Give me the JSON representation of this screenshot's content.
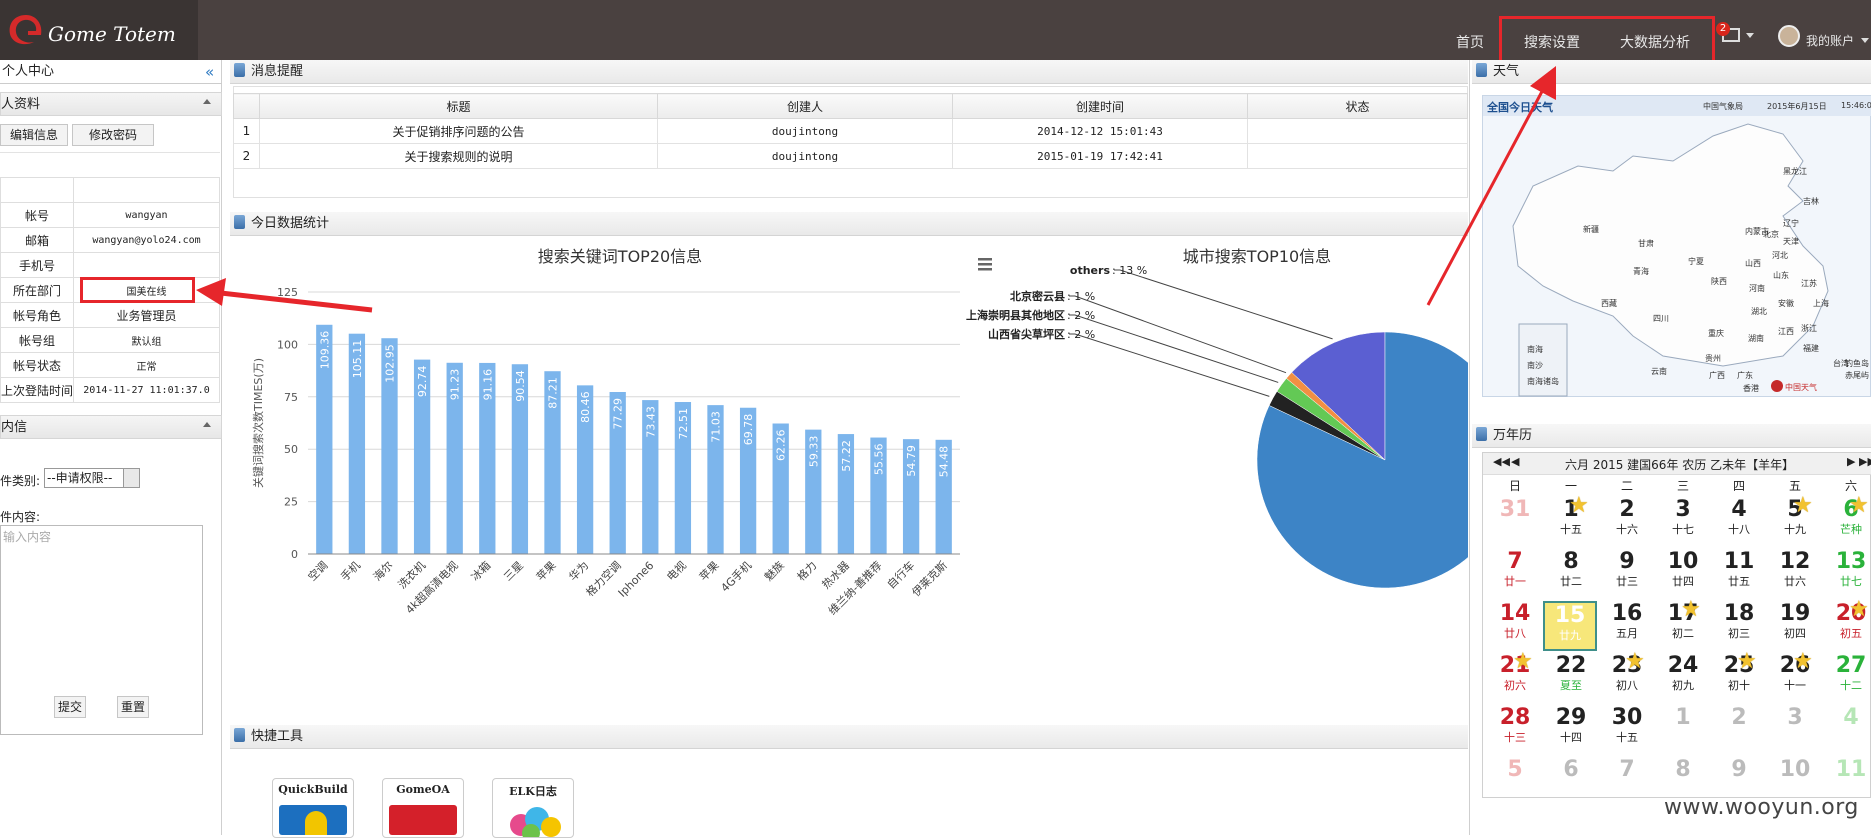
{
  "brand": {
    "logo_text": "Gome Totem"
  },
  "nav": {
    "home": "首页",
    "search_settings": "搜索设置",
    "bigdata": "大数据分析",
    "mail_badge": "2",
    "account": "我的账户"
  },
  "left": {
    "title": "个人中心",
    "profile_head": "人资料",
    "edit_info": "编辑信息",
    "change_pwd": "修改密码",
    "rows": [
      {
        "label": "帐号",
        "value": "wangyan"
      },
      {
        "label": "邮箱",
        "value": "wangyan@yolo24.com"
      },
      {
        "label": "手机号",
        "value": ""
      },
      {
        "label": "所在部门",
        "value": "国美在线"
      },
      {
        "label": "帐号角色",
        "value": "业务管理员"
      },
      {
        "label": "帐号组",
        "value": "默认组"
      },
      {
        "label": "帐号状态",
        "value": "正常"
      },
      {
        "label": "上次登陆时间",
        "value": "2014-11-27 11:01:37.0"
      }
    ],
    "letter_head": "内信",
    "type_label": "件类别:",
    "type_value": "--申请权限--",
    "content_label": "件内容:",
    "content_placeholder": "输入内容",
    "submit": "提交",
    "reset": "重置"
  },
  "messages": {
    "title": "消息提醒",
    "columns": [
      "标题",
      "创建人",
      "创建时间",
      "状态"
    ],
    "rows": [
      {
        "no": "1",
        "title": "关于促销排序问题的公告",
        "creator": "doujintong",
        "time": "2014-12-12 15:01:43",
        "status": ""
      },
      {
        "no": "2",
        "title": "关于搜索规则的说明",
        "creator": "doujintong",
        "time": "2015-01-19 17:42:41",
        "status": ""
      }
    ]
  },
  "stats": {
    "title": "今日数据统计"
  },
  "chart_data": [
    {
      "type": "bar",
      "title": "搜索关键词TOP20信息",
      "ylabel": "关键词搜索次数TIMES(万)",
      "xlabel": "",
      "ylim": [
        0,
        125
      ],
      "yticks": [
        0,
        25,
        50,
        75,
        100,
        125
      ],
      "categories": [
        "空调",
        "手机",
        "海尔",
        "洗衣机",
        "4k超高清电视",
        "冰箱",
        "三星",
        "苹果",
        "华为",
        "格力空调",
        "Iphone6",
        "电视",
        "苹果",
        "4G手机",
        "魅族",
        "格力",
        "热水器",
        "维兰纳-善推荐",
        "自行车",
        "伊莱克斯"
      ],
      "values": [
        109.36,
        105.11,
        102.95,
        92.74,
        91.23,
        91.16,
        90.54,
        87.21,
        80.46,
        77.29,
        73.43,
        72.51,
        71.03,
        69.78,
        62.26,
        59.33,
        57.22,
        55.56,
        54.79,
        54.48
      ],
      "color": "#7cb5ec",
      "grid": true,
      "legend": "none"
    },
    {
      "type": "pie",
      "title": "城市搜索TOP10信息",
      "slices": [
        {
          "label": "others",
          "value": 13,
          "color": "#5b5fd2"
        },
        {
          "label": "北京密云县",
          "value": 1,
          "color": "#f28f43"
        },
        {
          "label": "上海崇明县其他地区",
          "value": 2,
          "color": "#63c955"
        },
        {
          "label": "山西省尖草坪区",
          "value": 2,
          "color": "#222222"
        },
        {
          "label": "",
          "value": 82,
          "color": "#3d84c6"
        }
      ],
      "percent_suffix": " %"
    }
  ],
  "tools": {
    "title": "快捷工具",
    "items": [
      {
        "label": "QuickBuild"
      },
      {
        "label": "GomeOA"
      },
      {
        "label": "ELK日志"
      }
    ]
  },
  "weather": {
    "title": "天气",
    "map_title": "全国今日天气",
    "source": "中国气象局",
    "date": "2015年6月15日",
    "time": "15:46:0",
    "cities": [
      "黑龙江",
      "吉林",
      "辽宁",
      "内蒙古",
      "北京",
      "天津",
      "河北",
      "山西",
      "新疆",
      "甘肃",
      "宁夏",
      "山东",
      "青海",
      "陕西",
      "河南",
      "江苏",
      "西藏",
      "四川",
      "湖北",
      "安徽",
      "上海",
      "重庆",
      "湖南",
      "江西",
      "浙江",
      "贵州",
      "福建",
      "台湾",
      "云南",
      "广西",
      "广东",
      "香港",
      "澳门",
      "海南",
      "钓鱼岛",
      "赤尾屿"
    ],
    "inset": [
      "南海",
      "南沙",
      "南海诸岛"
    ],
    "corner": "中国天气"
  },
  "calendar": {
    "title": "万年历",
    "header": "六月 2015 建国66年 农历 乙未年【羊年】",
    "weekdays": [
      "日",
      "一",
      "二",
      "三",
      "四",
      "五",
      "六"
    ],
    "weeks": [
      [
        {
          "d": "31",
          "l": "",
          "t": "prev"
        },
        {
          "d": "1",
          "l": "十五",
          "t": "n",
          "s": true
        },
        {
          "d": "2",
          "l": "十六",
          "t": "n"
        },
        {
          "d": "3",
          "l": "十七",
          "t": "n"
        },
        {
          "d": "4",
          "l": "十八",
          "t": "n"
        },
        {
          "d": "5",
          "l": "十九",
          "t": "n",
          "s": true
        },
        {
          "d": "6",
          "l": "芒种",
          "t": "sat",
          "s": true
        }
      ],
      [
        {
          "d": "7",
          "l": "廿一",
          "t": "sun"
        },
        {
          "d": "8",
          "l": "廿二",
          "t": "n"
        },
        {
          "d": "9",
          "l": "廿三",
          "t": "n"
        },
        {
          "d": "10",
          "l": "廿四",
          "t": "n"
        },
        {
          "d": "11",
          "l": "廿五",
          "t": "n"
        },
        {
          "d": "12",
          "l": "廿六",
          "t": "n"
        },
        {
          "d": "13",
          "l": "廿七",
          "t": "sat"
        }
      ],
      [
        {
          "d": "14",
          "l": "廿八",
          "t": "sun"
        },
        {
          "d": "15",
          "l": "廿九",
          "t": "today"
        },
        {
          "d": "16",
          "l": "五月",
          "t": "n"
        },
        {
          "d": "17",
          "l": "初二",
          "t": "n",
          "s": true
        },
        {
          "d": "18",
          "l": "初三",
          "t": "n"
        },
        {
          "d": "19",
          "l": "初四",
          "t": "n"
        },
        {
          "d": "20",
          "l": "初五",
          "t": "sun",
          "s": true
        }
      ],
      [
        {
          "d": "21",
          "l": "初六",
          "t": "sun",
          "s": true
        },
        {
          "d": "22",
          "l": "夏至",
          "t": "n",
          "g": true
        },
        {
          "d": "23",
          "l": "初八",
          "t": "n",
          "s": true
        },
        {
          "d": "24",
          "l": "初九",
          "t": "n"
        },
        {
          "d": "25",
          "l": "初十",
          "t": "n",
          "s": true
        },
        {
          "d": "26",
          "l": "十一",
          "t": "n",
          "s": true
        },
        {
          "d": "27",
          "l": "十二",
          "t": "sat"
        }
      ],
      [
        {
          "d": "28",
          "l": "十三",
          "t": "sun"
        },
        {
          "d": "29",
          "l": "十四",
          "t": "n"
        },
        {
          "d": "30",
          "l": "十五",
          "t": "n"
        },
        {
          "d": "1",
          "l": "",
          "t": "next"
        },
        {
          "d": "2",
          "l": "",
          "t": "next"
        },
        {
          "d": "3",
          "l": "",
          "t": "next"
        },
        {
          "d": "4",
          "l": "",
          "t": "nextsat"
        }
      ],
      [
        {
          "d": "5",
          "l": "",
          "t": "nextsun"
        },
        {
          "d": "6",
          "l": "",
          "t": "next"
        },
        {
          "d": "7",
          "l": "",
          "t": "next"
        },
        {
          "d": "8",
          "l": "",
          "t": "next"
        },
        {
          "d": "9",
          "l": "",
          "t": "next"
        },
        {
          "d": "10",
          "l": "",
          "t": "next"
        },
        {
          "d": "11",
          "l": "",
          "t": "nextsat"
        }
      ]
    ]
  },
  "watermark": "www.wooyun.org"
}
